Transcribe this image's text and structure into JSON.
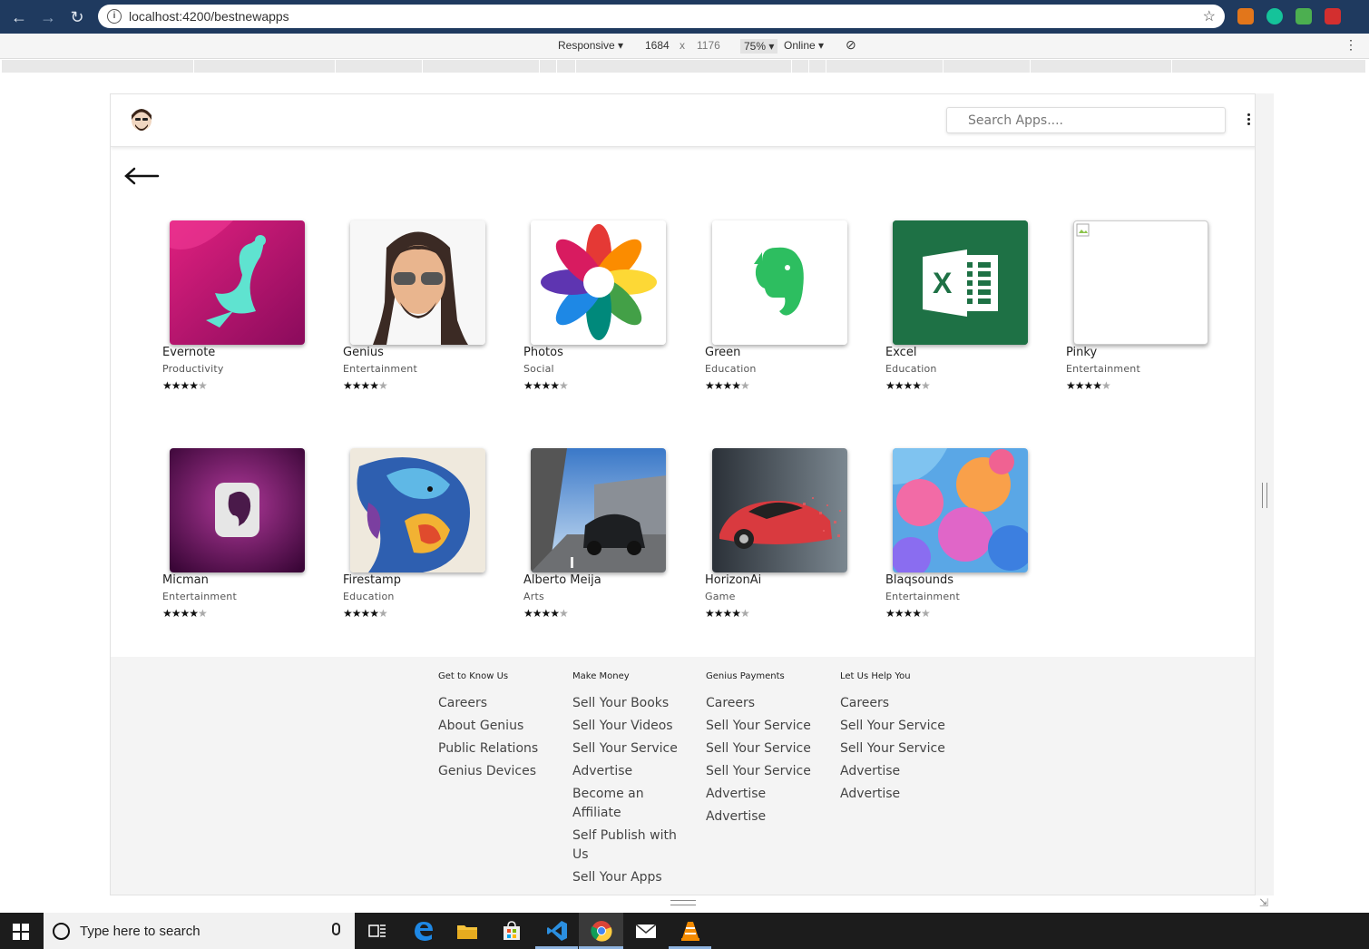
{
  "browser": {
    "url": "localhost:4200/bestnewapps",
    "device_mode": "Responsive",
    "width": "1684",
    "times": "x",
    "height": "1176",
    "zoom": "75%",
    "network": "Online"
  },
  "header": {
    "search_placeholder": "Search Apps...."
  },
  "apps": [
    {
      "name": "Evernote",
      "category": "Productivity",
      "rating": 4
    },
    {
      "name": "Genius",
      "category": "Entertainment",
      "rating": 4
    },
    {
      "name": "Photos",
      "category": "Social",
      "rating": 4
    },
    {
      "name": "Green",
      "category": "Education",
      "rating": 4
    },
    {
      "name": "Excel",
      "category": "Education",
      "rating": 4
    },
    {
      "name": "Pinky",
      "category": "Entertainment",
      "rating": 4
    },
    {
      "name": "Micman",
      "category": "Entertainment",
      "rating": 4
    },
    {
      "name": "Firestamp",
      "category": "Education",
      "rating": 4
    },
    {
      "name": "Alberto Meija",
      "category": "Arts",
      "rating": 4
    },
    {
      "name": "HorizonAi",
      "category": "Game",
      "rating": 4
    },
    {
      "name": "Blaqsounds",
      "category": "Entertainment",
      "rating": 4
    }
  ],
  "footer": {
    "columns": [
      {
        "heading": "Get to Know Us",
        "links": [
          "Careers",
          "About Genius",
          "Public Relations",
          "Genius Devices"
        ]
      },
      {
        "heading": "Make Money",
        "links": [
          "Sell Your Books",
          "Sell Your Videos",
          "Sell Your Service",
          "Advertise",
          "Become an Affiliate",
          "Self Publish with Us",
          "Sell Your Apps"
        ]
      },
      {
        "heading": "Genius Payments",
        "links": [
          "Careers",
          "Sell Your Service",
          "Sell Your Service",
          "Sell Your Service",
          "Advertise",
          "Advertise"
        ]
      },
      {
        "heading": "Let Us Help You",
        "links": [
          "Careers",
          "Sell Your Service",
          "Sell Your Service",
          "Advertise",
          "Advertise"
        ]
      }
    ]
  },
  "taskbar": {
    "search_text": "Type here to search",
    "icons": [
      "task-view-icon",
      "edge-icon",
      "file-explorer-icon",
      "store-icon",
      "vscode-icon",
      "chrome-icon",
      "mail-icon",
      "vlc-icon"
    ]
  },
  "colors": {
    "browser_chrome": "#1f3a5f",
    "footer_bg": "#f4f4f4",
    "excel_green": "#1e7145",
    "evernote_green": "#2dbe60"
  }
}
